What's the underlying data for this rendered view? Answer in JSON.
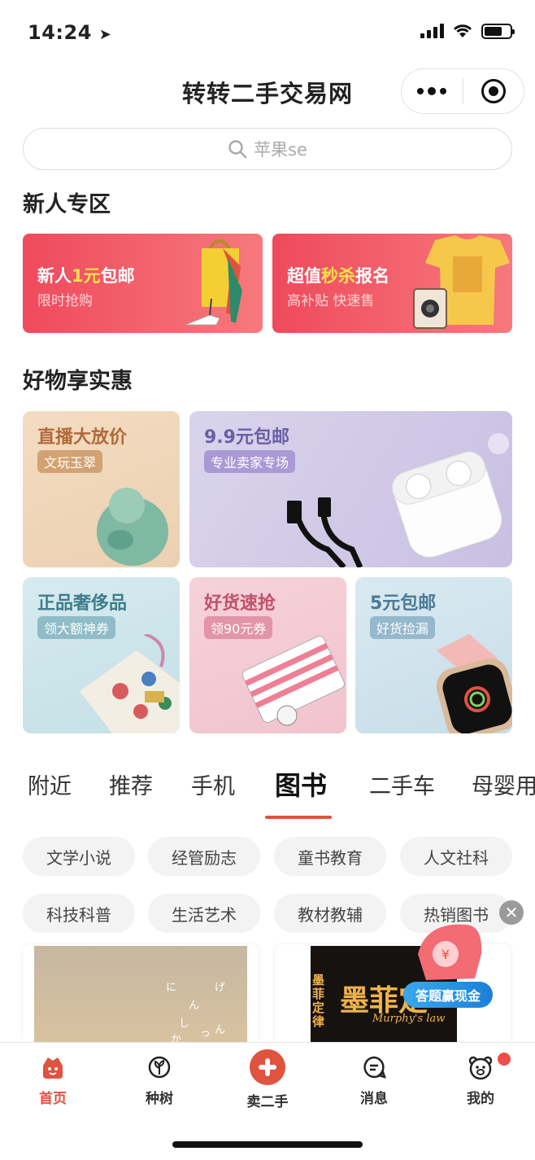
{
  "status_bar": {
    "time": "14:24"
  },
  "header": {
    "title": "转转二手交易网"
  },
  "search": {
    "placeholder": "苹果se"
  },
  "newcomer": {
    "title": "新人专区",
    "banners": [
      {
        "title_pre": "新人",
        "title_hl": "1元",
        "title_post": "包邮",
        "subtitle": "限时抢购"
      },
      {
        "title_pre": "超值",
        "title_hl": "秒杀",
        "title_post": "报名",
        "subtitle": "高补贴 快速售"
      }
    ]
  },
  "deals": {
    "title": "好物享实惠",
    "cards": [
      {
        "title": "直播大放价",
        "badge": "文玩玉翠"
      },
      {
        "title": "9.9元包邮",
        "badge": "专业卖家专场"
      },
      {
        "title": "正品奢侈品",
        "badge": "领大额神券"
      },
      {
        "title": "好货速抢",
        "badge": "领90元券"
      },
      {
        "title": "5元包邮",
        "badge": "好货捡漏"
      }
    ]
  },
  "tabs": [
    "附近",
    "推荐",
    "手机",
    "图书",
    "二手车",
    "母婴用"
  ],
  "active_tab": "图书",
  "chips": [
    "文学小说",
    "经管励志",
    "童书教育",
    "人文社科",
    "科技科普",
    "生活艺术",
    "教材教辅",
    "热销图书"
  ],
  "products": [
    {
      "cover_text": [
        "に",
        "ん",
        "げ",
        "ん",
        "し",
        "っ",
        "か"
      ]
    },
    {
      "cover_title": "墨菲定",
      "cover_side": "墨菲定律",
      "cover_sub": "Murphy's law"
    }
  ],
  "floating_badge": {
    "label": "答题赢现金"
  },
  "bottom_nav": [
    {
      "label": "首页",
      "icon": "home-face-icon",
      "active": true
    },
    {
      "label": "种树",
      "icon": "sprout-icon"
    },
    {
      "label": "卖二手",
      "icon": "plus-icon"
    },
    {
      "label": "消息",
      "icon": "message-icon"
    },
    {
      "label": "我的",
      "icon": "bear-face-icon"
    }
  ],
  "colors": {
    "accent": "#e0533f",
    "banner_red": "#ef4a5d",
    "highlight_yellow": "#ffe04d"
  }
}
